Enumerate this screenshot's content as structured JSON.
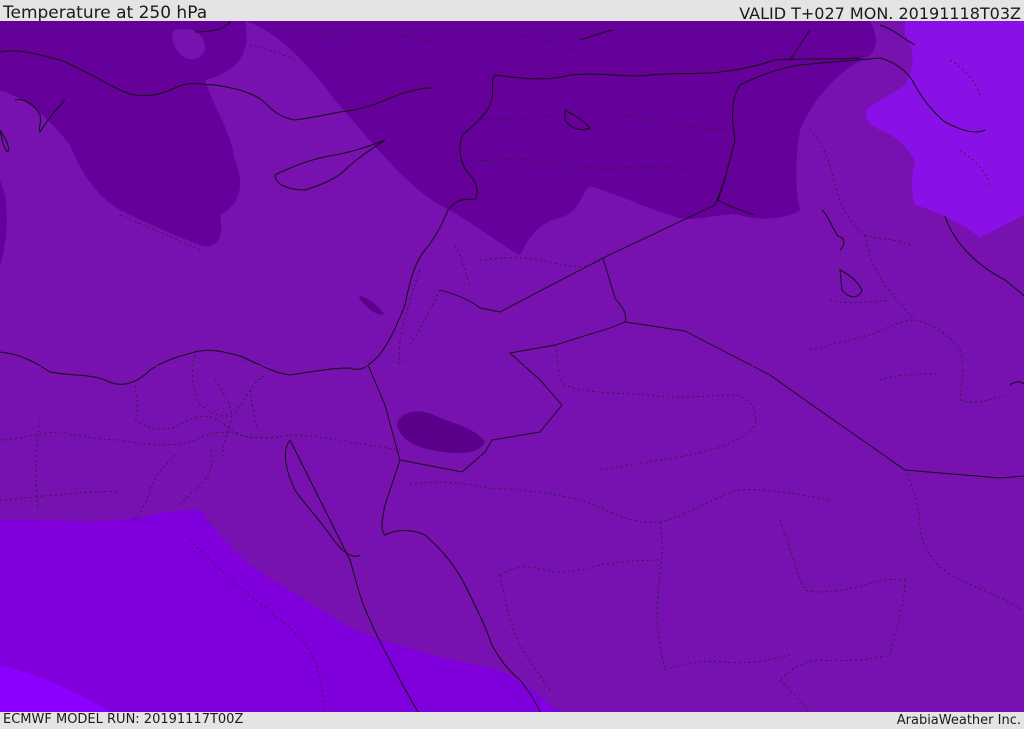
{
  "header": {
    "title": "Temperature at 250 hPa",
    "valid_time": "VALID T+027 MON. 20191118T03Z"
  },
  "footer": {
    "model_run": "ECMWF MODEL RUN: 20191117T00Z",
    "credit": "ArabiaWeather Inc."
  },
  "colors": {
    "frame": "#e4e4e4",
    "field_base": "#7711b0",
    "field_dark": "#65009a",
    "field_darkest": "#5a008a",
    "field_violet": "#8000dd",
    "field_bright": "#8c00ff",
    "field_east": "#8a10e8",
    "coastline": "#111111"
  }
}
